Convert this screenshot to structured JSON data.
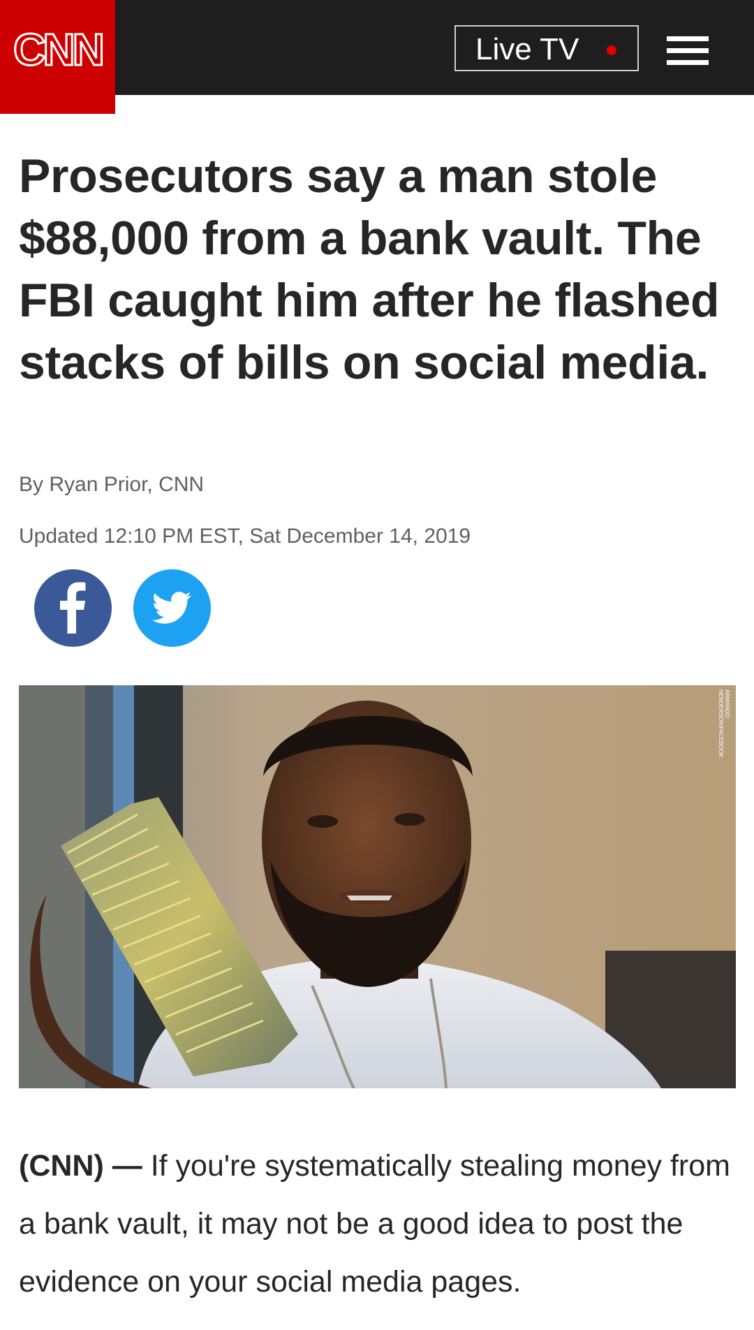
{
  "header": {
    "logo_text": "CNN",
    "live_tv_label": "Live TV",
    "live_dot_color": "#e00000",
    "brand_color": "#cc0000",
    "menu_icon": "hamburger-menu-icon"
  },
  "article": {
    "headline": "Prosecutors say a man stole $88,000 from a bank vault. The FBI caught him after he flashed stacks of bills on social media.",
    "byline": "By Ryan Prior, CNN",
    "updated": "Updated 12:10 PM EST, Sat December 14, 2019",
    "share": {
      "facebook_icon": "facebook-icon",
      "twitter_icon": "twitter-icon"
    },
    "photo": {
      "credit": "ARMANDO HENDERSON/FACEBOOK"
    },
    "lead_prefix": "(CNN) —",
    "lead_text": " If you're systematically stealing money from a bank vault, it may not be a good idea to post the evidence on your social media pages."
  }
}
